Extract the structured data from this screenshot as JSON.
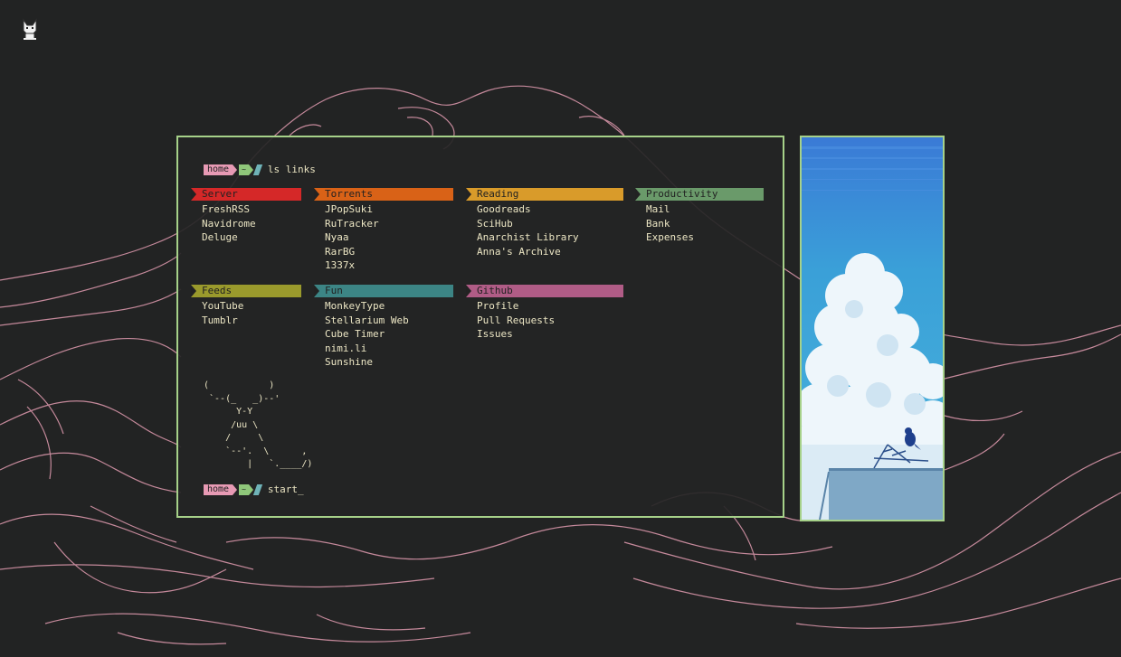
{
  "colors": {
    "background": "#222323",
    "border": "#a6d189",
    "wave_lines": "#d795a8",
    "text": "#ece6c4"
  },
  "icons": {
    "logo": "cat-icon",
    "side_image": "sky-clouds-crow-illustration"
  },
  "prompt_top": {
    "home": "home",
    "dir": "~",
    "command": "ls links"
  },
  "prompt_bottom": {
    "home": "home",
    "dir": "~",
    "command": "start_"
  },
  "categories": [
    {
      "title": "Server",
      "color": "#d52828",
      "links": [
        "FreshRSS",
        "Navidrome",
        "Deluge"
      ]
    },
    {
      "title": "Torrents",
      "color": "#d96217",
      "links": [
        "JPopSuki",
        "RuTracker",
        "Nyaa",
        "RarBG",
        "1337x"
      ]
    },
    {
      "title": "Reading",
      "color": "#d99b2a",
      "links": [
        "Goodreads",
        "SciHub",
        "Anarchist Library",
        "Anna's Archive"
      ]
    },
    {
      "title": "Productivity",
      "color": "#6a9a6a",
      "links": [
        "Mail",
        "Bank",
        "Expenses"
      ]
    },
    {
      "title": "Feeds",
      "color": "#9a9a2c",
      "links": [
        "YouTube",
        "Tumblr"
      ]
    },
    {
      "title": "Fun",
      "color": "#3c8585",
      "links": [
        "MonkeyType",
        "Stellarium Web",
        "Cube Timer",
        "nimi.li",
        "Sunshine"
      ]
    },
    {
      "title": "Github",
      "color": "#b05c86",
      "links": [
        "Profile",
        "Pull Requests",
        "Issues"
      ]
    }
  ],
  "ascii_art": "(           )\n `--(_   _)--'\n      Y-Y\n     /uu \\\n    /     \\\n    `--'.  \\      ,\n        |   `.____/)"
}
